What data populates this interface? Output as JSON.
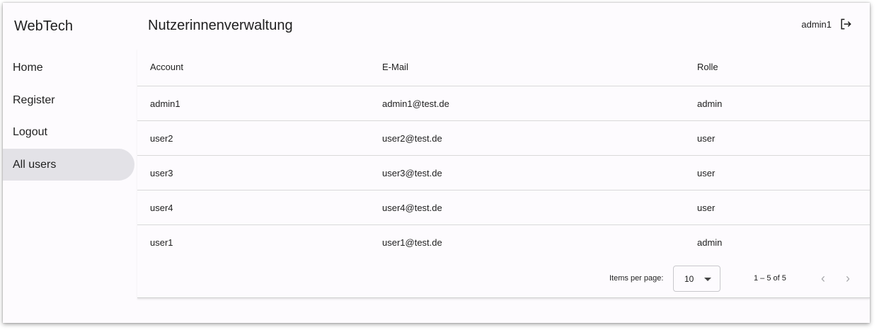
{
  "sidebar": {
    "brand": "WebTech",
    "items": [
      {
        "label": "Home",
        "active": false
      },
      {
        "label": "Register",
        "active": false
      },
      {
        "label": "Logout",
        "active": false
      },
      {
        "label": "All users",
        "active": true
      }
    ]
  },
  "header": {
    "title": "Nutzerinnenverwaltung",
    "username": "admin1",
    "logout_icon": "logout-icon"
  },
  "table": {
    "columns": [
      "Account",
      "E-Mail",
      "Rolle"
    ],
    "rows": [
      [
        "admin1",
        "admin1@test.de",
        "admin"
      ],
      [
        "user2",
        "user2@test.de",
        "user"
      ],
      [
        "user3",
        "user3@test.de",
        "user"
      ],
      [
        "user4",
        "user4@test.de",
        "user"
      ],
      [
        "user1",
        "user1@test.de",
        "admin"
      ]
    ]
  },
  "paginator": {
    "items_per_page_label": "Items per page:",
    "items_per_page_value": "10",
    "range_label": "1 – 5 of 5",
    "prev_icon": "chevron-left-icon",
    "next_icon": "chevron-right-icon",
    "prev_glyph": "‹",
    "next_glyph": "›"
  },
  "colors": {
    "background": "#fdfbfe",
    "active_nav": "#e3e2e7",
    "divider": "#d9d9d9",
    "disabled_icon": "#a8a8ac"
  }
}
